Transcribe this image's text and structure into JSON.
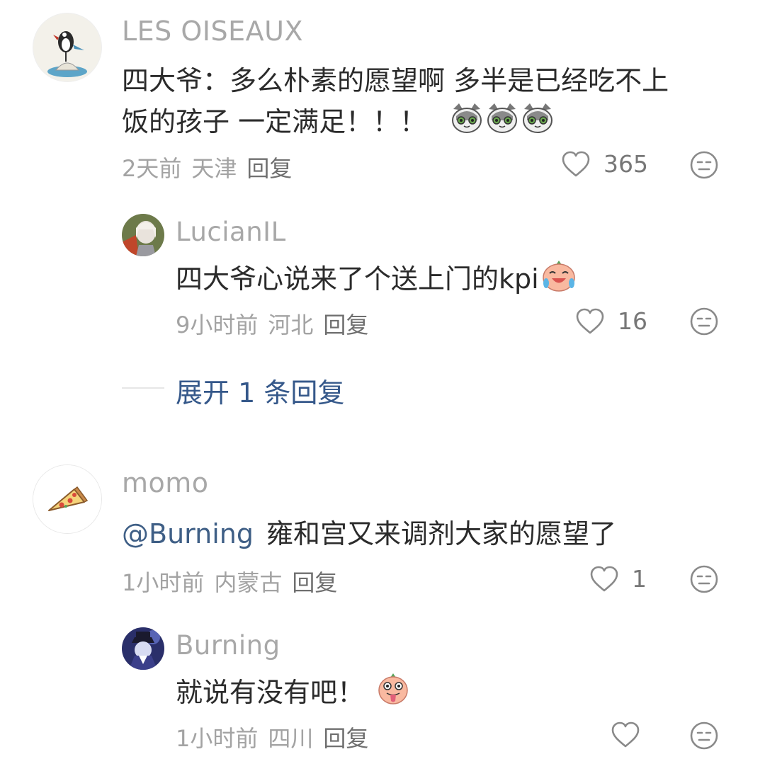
{
  "comments": [
    {
      "username": "LES OISEAUX",
      "text_line1": "四大爷：多么朴素的愿望啊 多半是已经吃不上",
      "text_line2": "饭的孩子 一定满足！！！",
      "emoji_icon": "cat-emoji",
      "time": "2天前",
      "location": "天津",
      "reply_label": "回复",
      "likes": "365",
      "replies": [
        {
          "username": "LucianIL",
          "text": "四大爷心说来了个送上门的kpi",
          "emoji_icon": "laugh-cry-peach-emoji",
          "time": "9小时前",
          "location": "河北",
          "reply_label": "回复",
          "likes": "16"
        }
      ],
      "expand_label": "展开 1 条回复"
    },
    {
      "username": "momo",
      "mention": "@Burning",
      "text": "雍和宫又来调剂大家的愿望了",
      "time": "1小时前",
      "location": "内蒙古",
      "reply_label": "回复",
      "likes": "1",
      "replies": [
        {
          "username": "Burning",
          "text": "就说有没有吧！",
          "emoji_icon": "tongue-peach-emoji",
          "time": "1小时前",
          "location": "四川",
          "reply_label": "回复",
          "likes": ""
        }
      ]
    }
  ],
  "colors": {
    "accent_link": "#35588a",
    "meta_gray": "#a3a3a3",
    "username_gray": "#a8a8a8"
  }
}
